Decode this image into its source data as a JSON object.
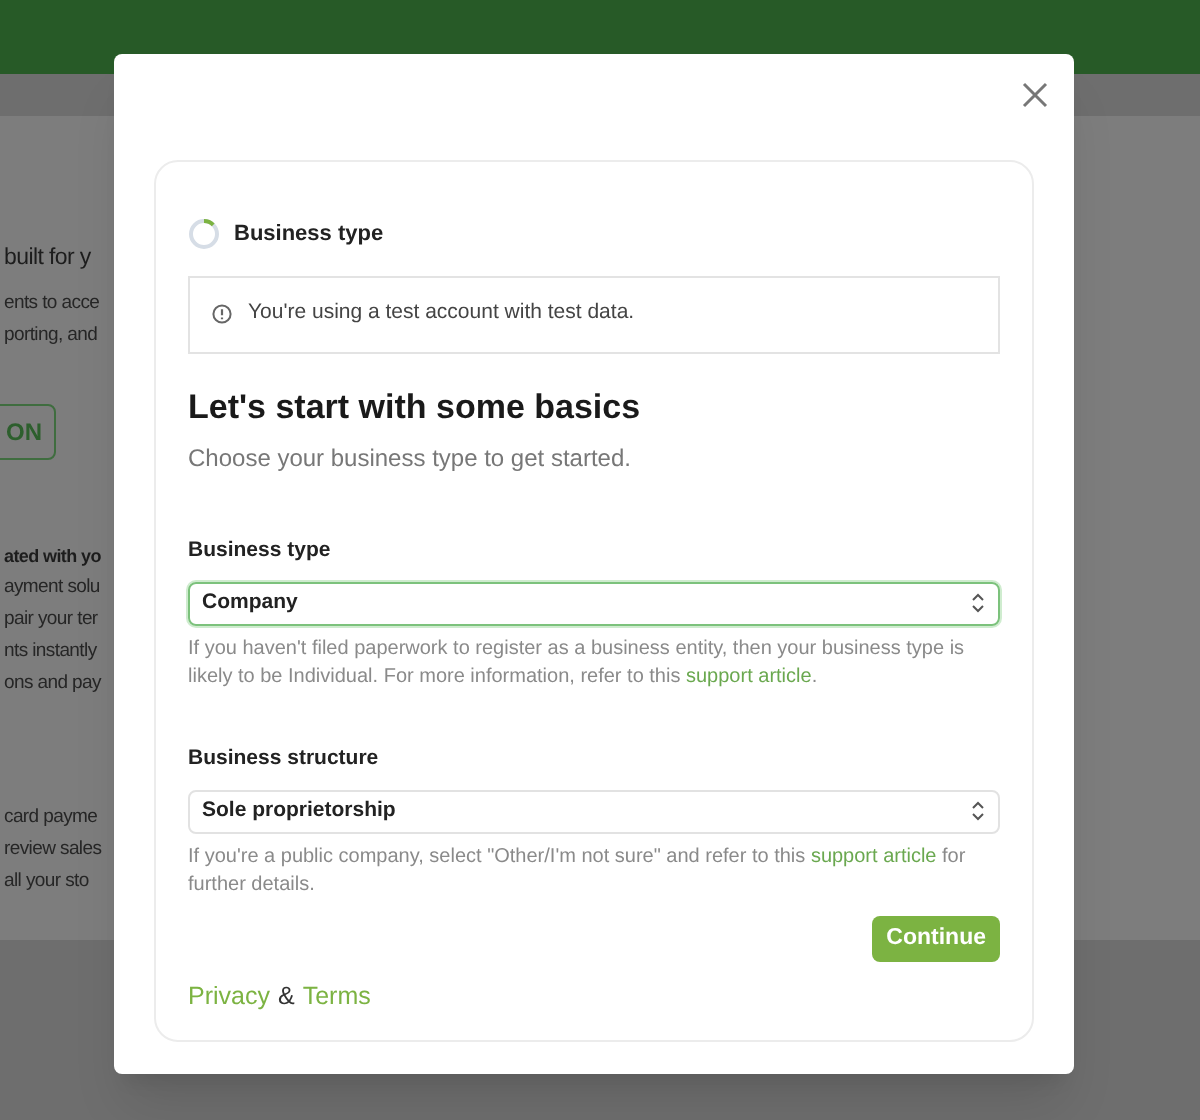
{
  "background_page": {
    "fragments": [
      {
        "kind": "title",
        "text": "built for y"
      },
      {
        "kind": "line",
        "text": "ents to acce"
      },
      {
        "kind": "line",
        "text": "porting, and"
      },
      {
        "kind": "button",
        "text": "ON"
      },
      {
        "kind": "bold",
        "text": "ated with yo"
      },
      {
        "kind": "line",
        "text": "ayment solu"
      },
      {
        "kind": "line",
        "text": "pair your ter"
      },
      {
        "kind": "line",
        "text": "nts instantly"
      },
      {
        "kind": "line",
        "text": "ons and pay"
      },
      {
        "kind": "gap"
      },
      {
        "kind": "line",
        "text": "card payme"
      },
      {
        "kind": "line",
        "text": "review sales"
      },
      {
        "kind": "line",
        "text": "all your sto"
      }
    ]
  },
  "modal": {
    "step": {
      "label": "Business type"
    },
    "notice": "You're using a test account with test data.",
    "heading": "Let's start with some basics",
    "subheading": "Choose your business type to get started.",
    "fields": [
      {
        "label": "Business type",
        "value": "Company",
        "focused": true,
        "help_before": "If you haven't filed paperwork to register as a business entity, then your business type is likely to be Individual. For more information, refer to this",
        "help_link": "support article",
        "help_after": "."
      },
      {
        "label": "Business structure",
        "value": "Sole proprietorship",
        "focused": false,
        "help_before": "If you're a public company, select \"Other/I'm not sure\" and refer to this",
        "help_link": "support article",
        "help_after": "for further details."
      }
    ],
    "continue_button": "Continue",
    "footer": {
      "privacy": "Privacy",
      "separator": "&",
      "terms": "Terms"
    }
  }
}
